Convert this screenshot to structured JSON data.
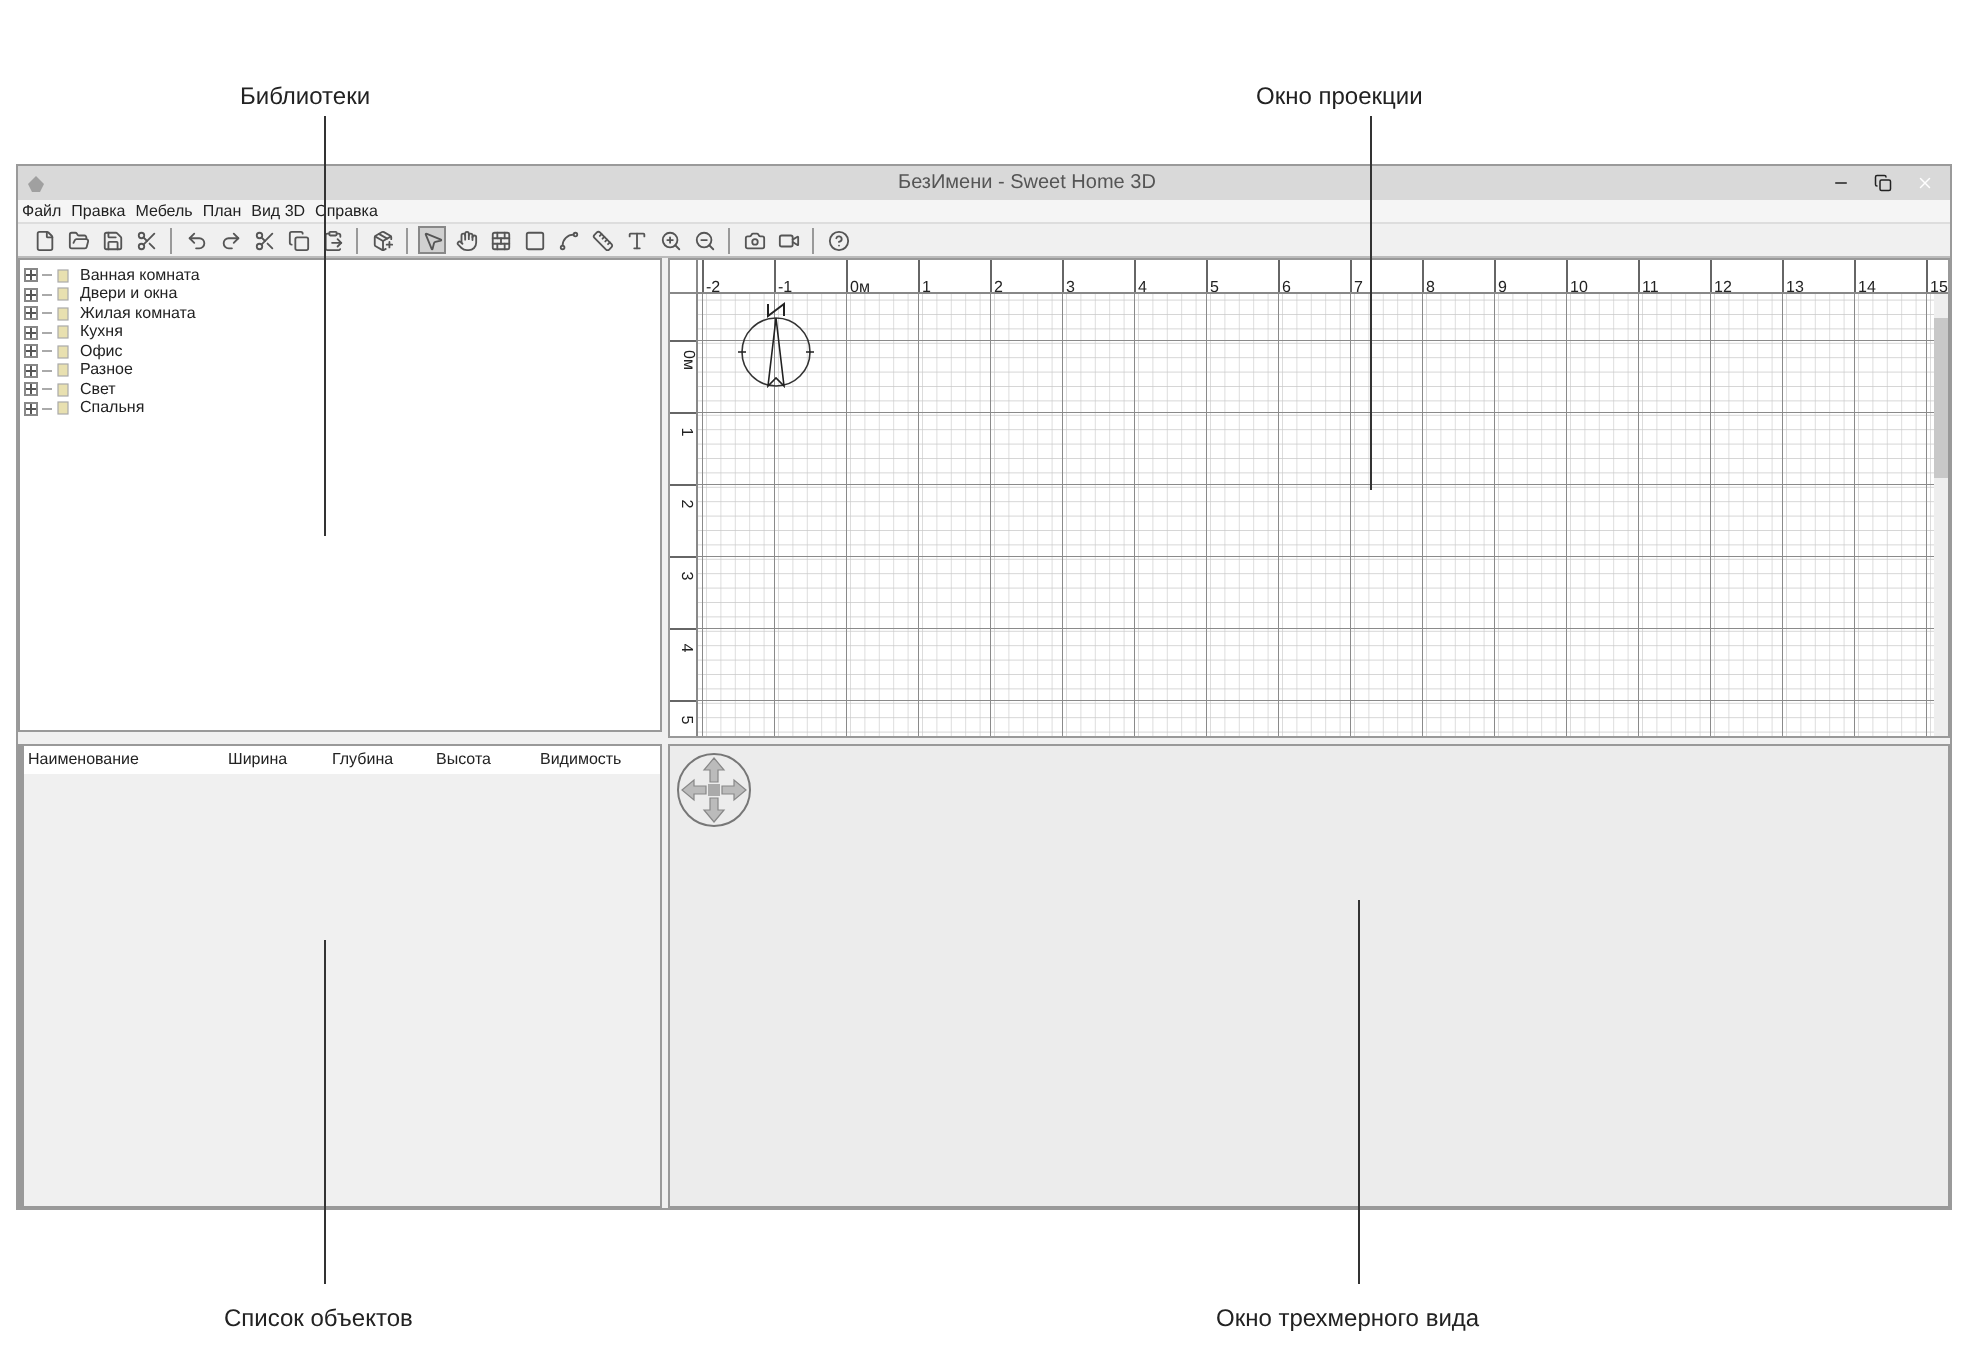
{
  "callouts": {
    "top": [
      "Библиотеки",
      "Окно проекции"
    ],
    "bottom": [
      "Список объектов",
      "Окно трехмерного вида"
    ]
  },
  "window": {
    "title": "БезИмени - Sweet Home 3D"
  },
  "menu": [
    "Файл",
    "Правка",
    "Мебель",
    "План",
    "Вид 3D",
    "Справка"
  ],
  "toolbar": [
    {
      "kind": "new"
    },
    {
      "kind": "open"
    },
    {
      "kind": "save"
    },
    {
      "kind": "cut"
    },
    {
      "kind": "separator"
    },
    {
      "kind": "undo"
    },
    {
      "kind": "redo"
    },
    {
      "kind": "cut"
    },
    {
      "kind": "copy"
    },
    {
      "kind": "paste"
    },
    {
      "kind": "separator"
    },
    {
      "kind": "add"
    },
    {
      "kind": "separator"
    },
    {
      "kind": "select",
      "selected": true
    },
    {
      "kind": "pan",
      "selected": false
    },
    {
      "kind": "walls",
      "selected": false
    },
    {
      "kind": "rooms",
      "selected": false
    },
    {
      "kind": "polylines",
      "selected": false
    },
    {
      "kind": "dimensions",
      "selected": false
    },
    {
      "kind": "text",
      "selected": false
    },
    {
      "kind": "zoomin"
    },
    {
      "kind": "zoomout"
    },
    {
      "kind": "separator"
    },
    {
      "kind": "photo"
    },
    {
      "kind": "video"
    },
    {
      "kind": "separator"
    },
    {
      "kind": "help"
    }
  ],
  "library": {
    "items": [
      {
        "label": "Ванная комната",
        "expanded": false
      },
      {
        "label": "Двери и окна",
        "expanded": false
      },
      {
        "label": "Жилая комната",
        "expanded": false
      },
      {
        "label": "Кухня",
        "expanded": false
      },
      {
        "label": "Офис",
        "expanded": false
      },
      {
        "label": "Разное",
        "expanded": false
      },
      {
        "label": "Свет",
        "expanded": false
      },
      {
        "label": "Спальня",
        "expanded": false
      }
    ]
  },
  "furniture_table": {
    "columns": [
      "Наименование",
      "Ширина",
      "Глубина",
      "Высота",
      "Видимость"
    ]
  },
  "plan": {
    "x_ruler": [
      "-2",
      "-1",
      "0м",
      "1",
      "2",
      "3",
      "4",
      "5",
      "6",
      "7",
      "8",
      "9",
      "10",
      "11",
      "12",
      "13",
      "14",
      "15"
    ],
    "y_ruler": [
      "0м",
      "1",
      "2",
      "3",
      "4",
      "5"
    ]
  }
}
